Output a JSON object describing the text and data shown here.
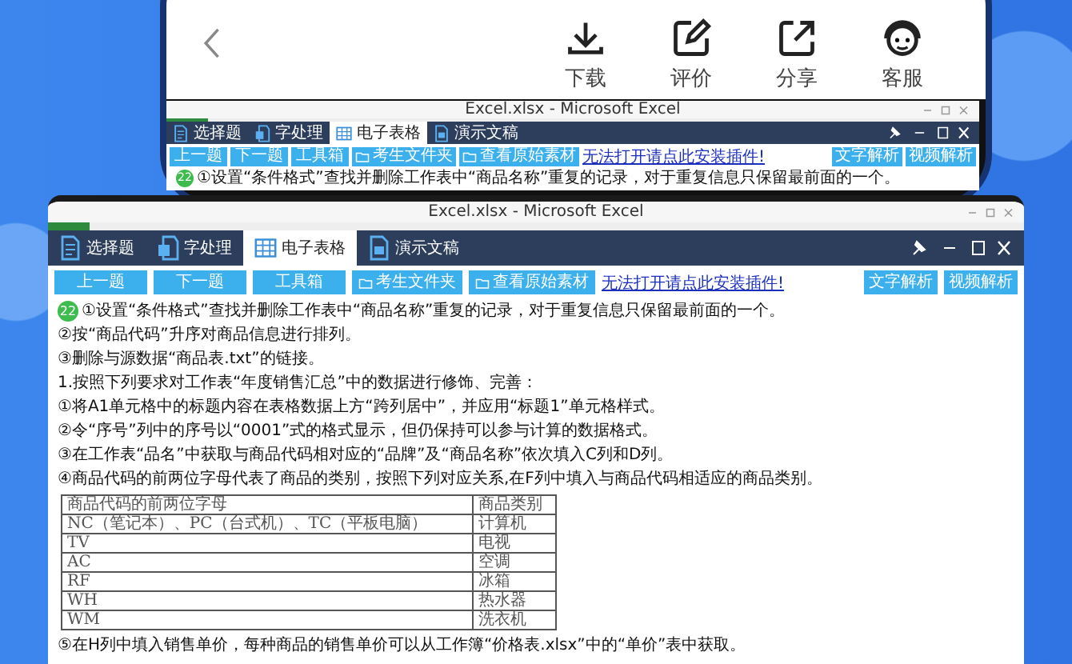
{
  "phone": {
    "nav_actions": [
      {
        "kind": "download",
        "label": "下载"
      },
      {
        "kind": "review",
        "label": "评价"
      },
      {
        "kind": "share",
        "label": "分享"
      },
      {
        "kind": "service",
        "label": "客服"
      }
    ],
    "preview_window": {
      "title": "Excel.xlsx - Microsoft Excel",
      "tabs": [
        {
          "kind": "choice",
          "label": "选择题",
          "selected": false
        },
        {
          "kind": "word",
          "label": "字处理",
          "selected": false
        },
        {
          "kind": "sheet",
          "label": "电子表格",
          "selected": true
        },
        {
          "kind": "slides",
          "label": "演示文稿",
          "selected": false
        }
      ],
      "buttons": [
        "上一题",
        "下一题",
        "工具箱"
      ],
      "file_buttons": [
        "考生文件夹",
        "查看原始素材"
      ],
      "link": "无法打开请点此安装插件!",
      "analysis_buttons": [
        "文字解析",
        "视频解析"
      ],
      "question_number": "22",
      "lines": [
        {
          "kind": "text",
          "text": "①设置“条件格式”查找并删除工作表中“商品名称”重复的记录，对于重复信息只保留最前面的一个。"
        }
      ]
    }
  },
  "excel_window": {
    "title": "Excel.xlsx - Microsoft Excel",
    "tabs": [
      {
        "kind": "choice",
        "label": "选择题",
        "selected": false
      },
      {
        "kind": "word",
        "label": "字处理",
        "selected": false
      },
      {
        "kind": "sheet",
        "label": "电子表格",
        "selected": true
      },
      {
        "kind": "slides",
        "label": "演示文稿",
        "selected": false
      }
    ],
    "buttons": [
      "上一题",
      "下一题",
      "工具箱"
    ],
    "file_buttons": [
      "考生文件夹",
      "查看原始素材"
    ],
    "link": "无法打开请点此安装插件!",
    "analysis_buttons": [
      "文字解析",
      "视频解析"
    ],
    "question_number": "22",
    "lines": [
      {
        "kind": "text",
        "text": "①设置“条件格式”查找并删除工作表中“商品名称”重复的记录，对于重复信息只保留最前面的一个。"
      },
      {
        "kind": "text",
        "text": "②按“商品代码”升序对商品信息进行排列。"
      },
      {
        "kind": "text",
        "text": "③删除与源数据“商品表.txt”的链接。"
      },
      {
        "kind": "text",
        "text": "1.按照下列要求对工作表“年度销售汇总”中的数据进行修饰、完善："
      },
      {
        "kind": "text",
        "text": "①将A1单元格中的标题内容在表格数据上方“跨列居中”，并应用“标题1”单元格样式。"
      },
      {
        "kind": "text",
        "text": "②令“序号”列中的序号以“0001”式的格式显示，但仍保持可以参与计算的数据格式。"
      },
      {
        "kind": "text",
        "text": "③在工作表“品名”中获取与商品代码相对应的“品牌”及“商品名称”依次填入C列和D列。"
      },
      {
        "kind": "text",
        "text": "④商品代码的前两位字母代表了商品的类别，按照下列对应关系,在F列中填入与商品代码相适应的商品类别。"
      },
      {
        "kind": "table",
        "rows": [
          [
            "商品代码的前两位字母",
            "商品类别"
          ],
          [
            "NC（笔记本）、PC（台式机）、TC（平板电脑）",
            "计算机"
          ],
          [
            "TV",
            "电视"
          ],
          [
            "AC",
            "空调"
          ],
          [
            "RF",
            "冰箱"
          ],
          [
            "WH",
            "热水器"
          ],
          [
            "WM",
            "洗衣机"
          ]
        ]
      },
      {
        "kind": "text",
        "text": "⑤在H列中填入销售单价，每种商品的销售单价可以从工作簿“价格表.xlsx”中的“单价”表中获取。"
      }
    ]
  }
}
